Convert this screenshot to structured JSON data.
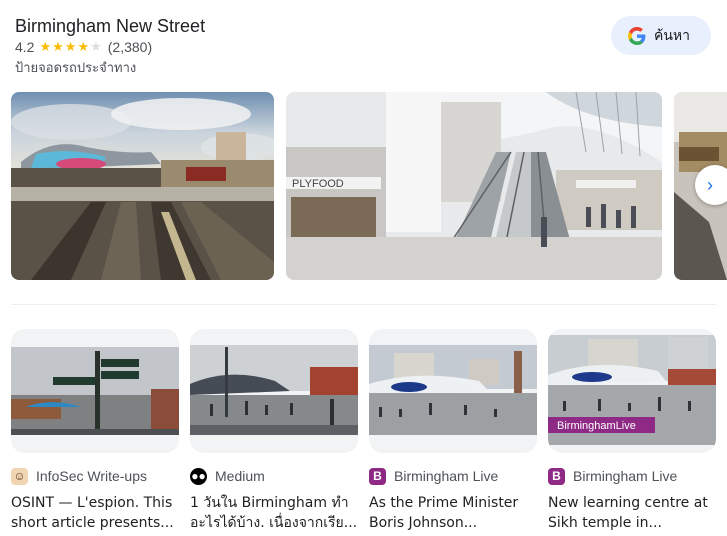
{
  "place": {
    "title": "Birmingham New Street",
    "rating": "4.2",
    "rating_value": 4.2,
    "reviews": "(2,380)",
    "category": "ป้ายจอดรถประจำทาง"
  },
  "search_button": {
    "label": "ค้นหา",
    "icon": "google-g-icon"
  },
  "colors": {
    "star": "#fbbc04",
    "accent": "#1a73e8",
    "button_bg": "#e8f0fe"
  },
  "photos": [
    {
      "description_icon": "station-exterior-photo"
    },
    {
      "description_icon": "grand-central-escalator-photo"
    },
    {
      "description_icon": "station-interior-photo"
    }
  ],
  "articles": [
    {
      "source": "InfoSec Write-ups",
      "icon": "infosec-icon",
      "headline": "OSINT — L'espion. This short article presents..."
    },
    {
      "source": "Medium",
      "icon": "medium-icon",
      "headline": "1 วันใน Birmingham ทำอะไรได้บ้าง. เนื่องจากเรีย..."
    },
    {
      "source": "Birmingham Live",
      "icon": "b-icon",
      "headline": "As the Prime Minister Boris Johnson..."
    },
    {
      "source": "Birmingham Live",
      "icon": "b-icon",
      "headline": "New learning centre at Sikh temple in..."
    }
  ],
  "overlay": {
    "brand_label": "BirminghamLive"
  }
}
